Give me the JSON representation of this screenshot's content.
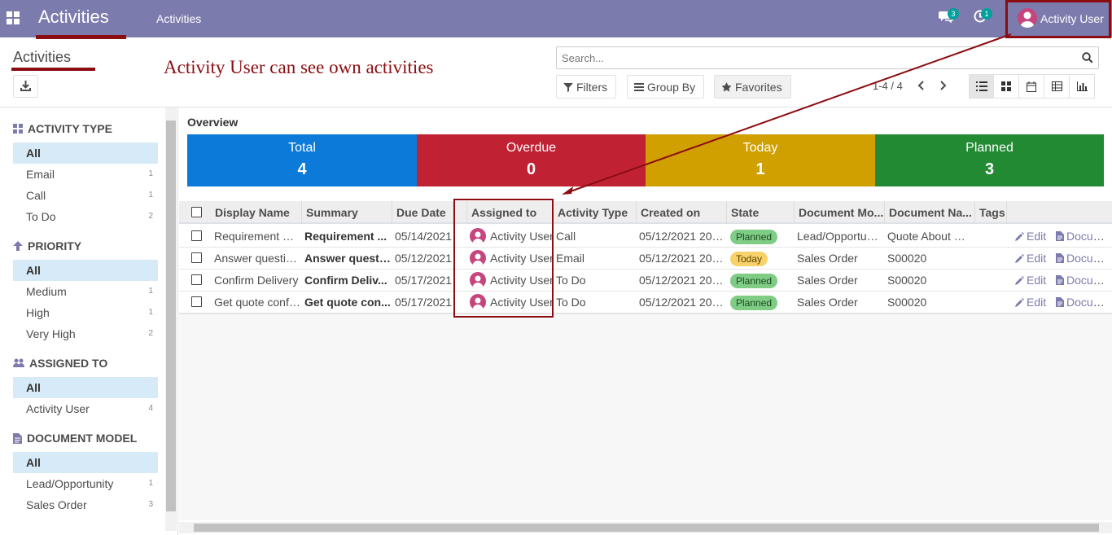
{
  "navbar": {
    "brand": "Activities",
    "menu_item": "Activities",
    "messages_badge": "3",
    "activities_badge": "1",
    "user_name": "Activity User"
  },
  "control_panel": {
    "breadcrumb": "Activities",
    "annotation": "Activity User can see own activities",
    "search_placeholder": "Search...",
    "filters_label": "Filters",
    "groupby_label": "Group By",
    "favorites_label": "Favorites",
    "pager": "1-4 / 4"
  },
  "search_panel": {
    "sections": [
      {
        "title": "Activity Type",
        "items": [
          {
            "label": "All",
            "count": ""
          },
          {
            "label": "Email",
            "count": "1"
          },
          {
            "label": "Call",
            "count": "1"
          },
          {
            "label": "To Do",
            "count": "2"
          }
        ]
      },
      {
        "title": "Priority",
        "items": [
          {
            "label": "All",
            "count": ""
          },
          {
            "label": "Medium",
            "count": "1"
          },
          {
            "label": "High",
            "count": "1"
          },
          {
            "label": "Very High",
            "count": "2"
          }
        ]
      },
      {
        "title": "Assigned To",
        "items": [
          {
            "label": "All",
            "count": ""
          },
          {
            "label": "Activity User",
            "count": "4"
          }
        ]
      },
      {
        "title": "Document Model",
        "items": [
          {
            "label": "All",
            "count": ""
          },
          {
            "label": "Lead/Opportunity",
            "count": "1"
          },
          {
            "label": "Sales Order",
            "count": "3"
          }
        ]
      }
    ]
  },
  "overview": {
    "label": "Overview",
    "stats": [
      {
        "label": "Total",
        "value": "4",
        "color": "#0b7ad8"
      },
      {
        "label": "Overdue",
        "value": "0",
        "color": "#c02133"
      },
      {
        "label": "Today",
        "value": "1",
        "color": "#d09f00"
      },
      {
        "label": "Planned",
        "value": "3",
        "color": "#238a34"
      }
    ]
  },
  "table": {
    "columns": [
      "Display Name",
      "Summary",
      "Due Date",
      "Assigned to",
      "Activity Type",
      "Created on",
      "State",
      "Document Mo...",
      "Document Na...",
      "Tags"
    ],
    "rows": [
      {
        "display_name": "Requirement G...",
        "summary": "Requirement ...",
        "due_date": "05/14/2021",
        "assigned_to": "Activity User",
        "activity_type": "Call",
        "created_on": "05/12/2021 20:...",
        "state": "Planned",
        "doc_model": "Lead/Opportunity",
        "doc_name": "Quote About M...",
        "edit": "Edit",
        "document": "Document"
      },
      {
        "display_name": "Answer questions",
        "summary": "Answer questi...",
        "due_date": "05/12/2021",
        "assigned_to": "Activity User",
        "activity_type": "Email",
        "created_on": "05/12/2021 20:...",
        "state": "Today",
        "doc_model": "Sales Order",
        "doc_name": "S00020",
        "edit": "Edit",
        "document": "Document"
      },
      {
        "display_name": "Confirm Delivery",
        "summary": "Confirm Deliv...",
        "due_date": "05/17/2021",
        "assigned_to": "Activity User",
        "activity_type": "To Do",
        "created_on": "05/12/2021 20:...",
        "state": "Planned",
        "doc_model": "Sales Order",
        "doc_name": "S00020",
        "edit": "Edit",
        "document": "Document"
      },
      {
        "display_name": "Get quote confi...",
        "summary": "Get quote con...",
        "due_date": "05/17/2021",
        "assigned_to": "Activity User",
        "activity_type": "To Do",
        "created_on": "05/12/2021 20:...",
        "state": "Planned",
        "doc_model": "Sales Order",
        "doc_name": "S00020",
        "edit": "Edit",
        "document": "Document"
      }
    ]
  },
  "colors": {
    "navbar": "#7c7bad",
    "annotation": "#8b0d12",
    "active_filter": "#d6ebf7"
  }
}
